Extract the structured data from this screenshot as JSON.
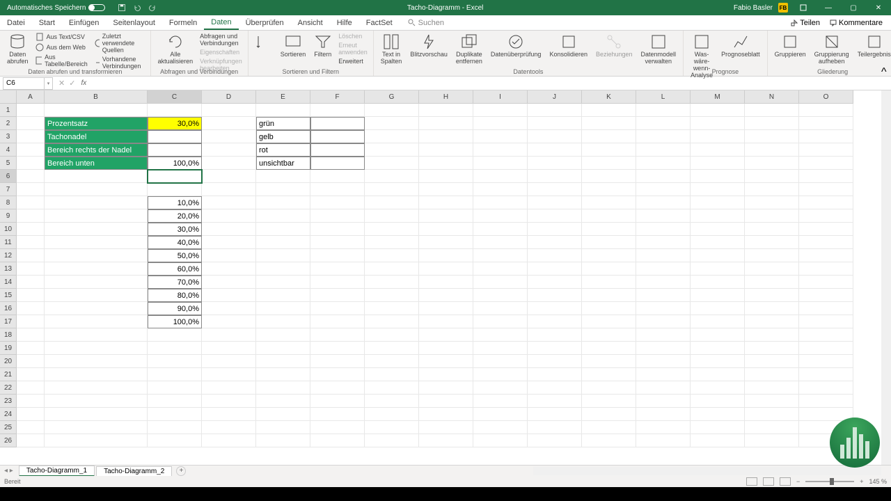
{
  "titlebar": {
    "autosave": "Automatisches Speichern",
    "title": "Tacho-Diagramm - Excel",
    "user": "Fabio Basler",
    "user_initials": "FB"
  },
  "menu": {
    "tabs": [
      "Datei",
      "Start",
      "Einfügen",
      "Seitenlayout",
      "Formeln",
      "Daten",
      "Überprüfen",
      "Ansicht",
      "Hilfe",
      "FactSet"
    ],
    "active": "Daten",
    "search": "Suchen",
    "share": "Teilen",
    "comments": "Kommentare"
  },
  "ribbon": {
    "g1": {
      "big": "Daten\nabrufen",
      "items": [
        "Aus Text/CSV",
        "Aus dem Web",
        "Aus Tabelle/Bereich",
        "Zuletzt verwendete Quellen",
        "Vorhandene Verbindungen"
      ],
      "label": "Daten abrufen und transformieren"
    },
    "g2": {
      "big": "Alle\naktualisieren",
      "items": [
        "Abfragen und Verbindungen",
        "Eigenschaften",
        "Verknüpfungen bearbeiten"
      ],
      "label": "Abfragen und Verbindungen"
    },
    "g3": {
      "sort": "Sortieren",
      "filter": "Filtern",
      "items": [
        "Löschen",
        "Erneut anwenden",
        "Erweitert"
      ],
      "label": "Sortieren und Filtern"
    },
    "g4": {
      "items": [
        "Text in\nSpalten",
        "Blitzvorschau",
        "Duplikate\nentfernen",
        "Datenüberprüfung",
        "Konsolidieren",
        "Beziehungen",
        "Datenmodell\nverwalten"
      ],
      "label": "Datentools"
    },
    "g5": {
      "items": [
        "Was-wäre-wenn-\nAnalyse",
        "Prognoseblatt"
      ],
      "label": "Prognose"
    },
    "g6": {
      "items": [
        "Gruppieren",
        "Gruppierung\naufheben",
        "Teilergebnis"
      ],
      "label": "Gliederung"
    }
  },
  "namebox": "C6",
  "columns": [
    "A",
    "B",
    "C",
    "D",
    "E",
    "F",
    "G",
    "H",
    "I",
    "J",
    "K",
    "L",
    "M",
    "N",
    "O"
  ],
  "rows": 26,
  "cells": {
    "B2": "Prozentsatz",
    "C2": "30,0%",
    "B3": "Tachonadel",
    "B4": "Bereich rechts der Nadel",
    "B5": "Bereich unten",
    "C5": "100,0%",
    "E2": "grün",
    "E3": "gelb",
    "E4": "rot",
    "E5": "unsichtbar",
    "C8": "10,0%",
    "C9": "20,0%",
    "C10": "30,0%",
    "C11": "40,0%",
    "C12": "50,0%",
    "C13": "60,0%",
    "C14": "70,0%",
    "C15": "80,0%",
    "C16": "90,0%",
    "C17": "100,0%"
  },
  "sheets": {
    "tabs": [
      "Tacho-Diagramm_1",
      "Tacho-Diagramm_2"
    ],
    "active": 0
  },
  "status": {
    "ready": "Bereit",
    "zoom": "145 %"
  }
}
